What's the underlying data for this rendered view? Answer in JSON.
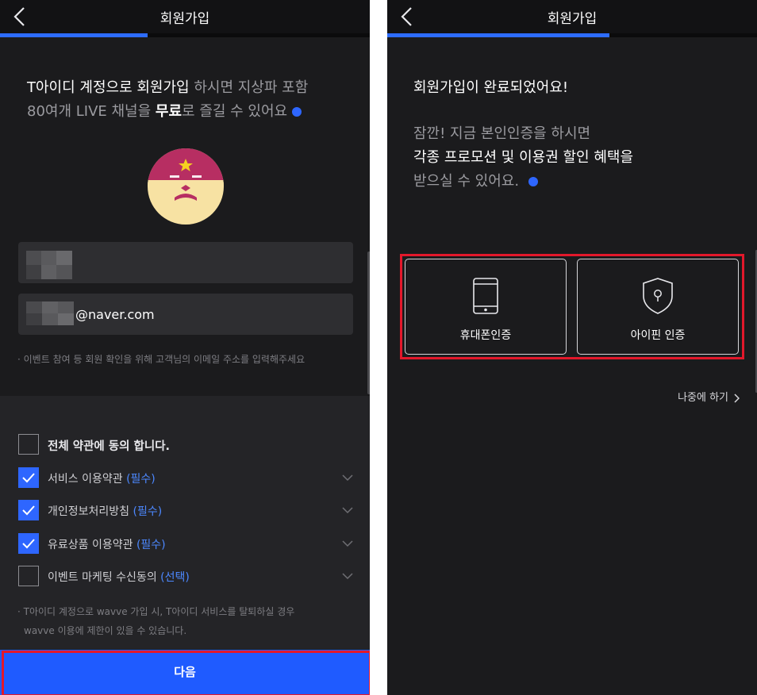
{
  "left": {
    "header": {
      "title": "회원가입"
    },
    "progress_fraction": 0.4,
    "intro": {
      "part1": "T아이디 계정으로 회원가입",
      "part2": " 하시면 지상파 포함",
      "part3": "80여개 LIVE 채널을 ",
      "part4": "무료",
      "part5": "로 즐길 수 있어요"
    },
    "email_suffix": "@naver.com",
    "email_hint": "· 이벤트 참여 등 회원 확인을 위해 고객님의 이메일 주소를 입력해주세요",
    "terms": {
      "all_label": "전체 약관에 동의 합니다.",
      "items": [
        {
          "label": "서비스 이용약관",
          "tag": "(필수)",
          "checked": true
        },
        {
          "label": "개인정보처리방침",
          "tag": "(필수)",
          "checked": true
        },
        {
          "label": "유료상품 이용약관",
          "tag": "(필수)",
          "checked": true
        },
        {
          "label": "이벤트 마케팅 수신동의",
          "tag": "(선택)",
          "checked": false
        }
      ],
      "notice_line1": "· T아이디 계정으로 wavve 가입 시, T아이디 서비스를 탈퇴하실 경우",
      "notice_line2": "wavve 이용에 제한이 있을 수 있습니다."
    },
    "next_button": "다음"
  },
  "right": {
    "header": {
      "title": "회원가입"
    },
    "progress_fraction": 0.6,
    "complete_message": "회원가입이 완료되었어요!",
    "promo": {
      "line1": "잠깐! 지금 본인인증을 하시면",
      "line2": "각종 프로모션 및 이용권 할인 혜택을",
      "line3": "받으실 수 있어요."
    },
    "verify_phone": "휴대폰인증",
    "verify_ipin": "아이핀 인증",
    "later": "나중에 하기"
  },
  "colors": {
    "accent": "#2e66ff",
    "highlight": "#e3182b",
    "background": "#1b1b1d"
  },
  "icons": {
    "back": "chevron-left-icon",
    "expand": "chevron-down-icon",
    "check": "check-icon",
    "phone": "smartphone-icon",
    "ipin": "shield-keyhole-icon",
    "later": "chevron-right-icon"
  }
}
